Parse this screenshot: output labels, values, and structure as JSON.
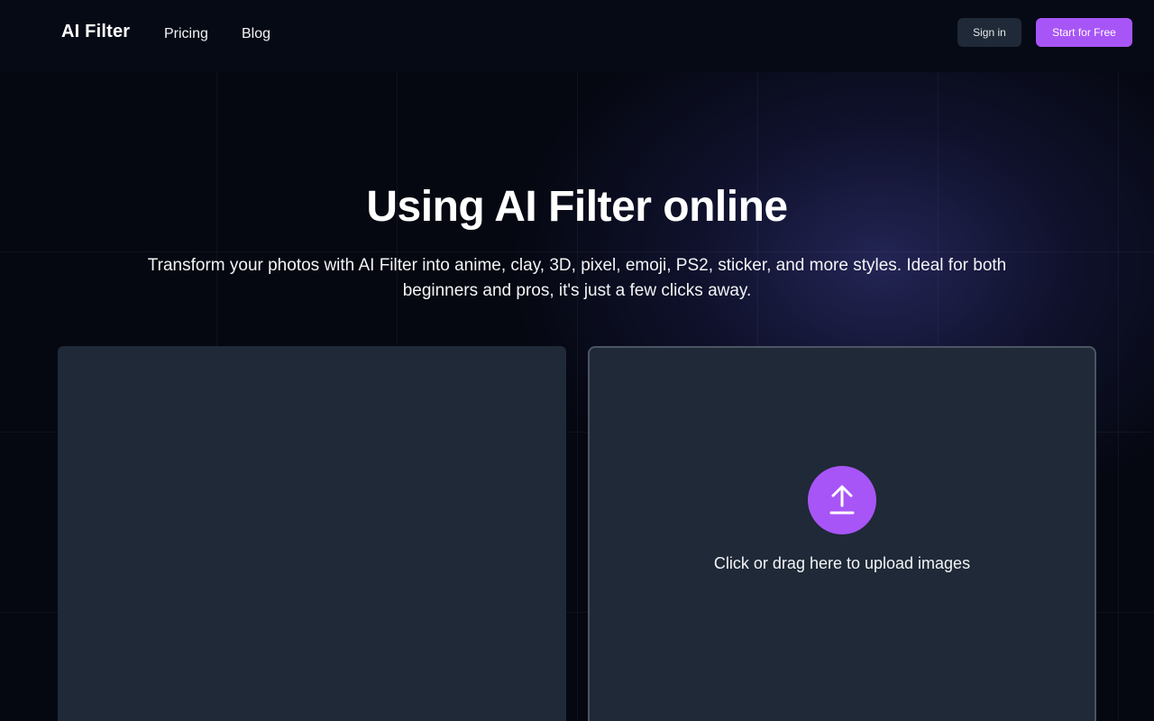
{
  "header": {
    "logo": "AI Filter",
    "nav": [
      {
        "label": "Pricing"
      },
      {
        "label": "Blog"
      }
    ],
    "sign_in_label": "Sign in",
    "start_label": "Start for Free"
  },
  "hero": {
    "title": "Using AI Filter online",
    "subtitle": "Transform your photos with AI Filter into anime, clay, 3D, pixel, emoji, PS2, sticker, and more styles. Ideal for both beginners and pros, it's just a few clicks away."
  },
  "upload": {
    "label": "Click or drag here to upload images",
    "icon": "upload-arrow-icon"
  },
  "colors": {
    "background": "#050811",
    "accent": "#a855f7",
    "panel": "#1f2937",
    "panel_border": "#4b5563"
  }
}
